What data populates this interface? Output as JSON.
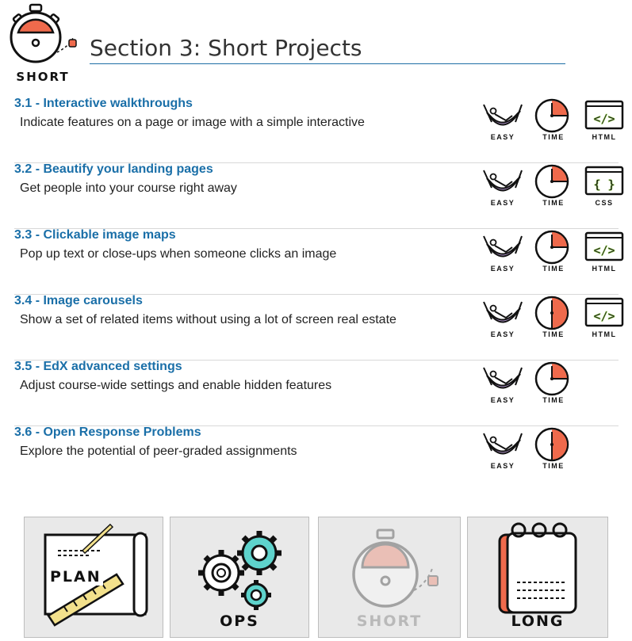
{
  "header": {
    "logo_label": "SHORT",
    "title": "Section 3: Short Projects"
  },
  "badges": {
    "easy": "EASY",
    "time": "TIME"
  },
  "projects": [
    {
      "title": "3.1 - Interactive walkthroughs",
      "desc": "Indicate features on a page or image with a simple interactive",
      "code_label": "HTML",
      "code_icon": "html-code-icon",
      "time_fraction": 0.25
    },
    {
      "title": "3.2 - Beautify your landing pages",
      "desc": "Get people into your course right away",
      "code_label": "CSS",
      "code_icon": "css-braces-icon",
      "time_fraction": 0.25
    },
    {
      "title": "3.3 - Clickable image maps",
      "desc": "Pop up text or close-ups when someone clicks an image",
      "code_label": "HTML",
      "code_icon": "html-code-icon",
      "time_fraction": 0.25
    },
    {
      "title": "3.4 - Image carousels",
      "desc": "Show a set of related items without using a lot of screen real estate",
      "code_label": "HTML",
      "code_icon": "html-code-icon",
      "time_fraction": 0.5
    },
    {
      "title": "3.5 - EdX advanced settings",
      "desc": "Adjust course-wide settings and enable hidden features",
      "code_label": "",
      "code_icon": "",
      "time_fraction": 0.25
    },
    {
      "title": "3.6 - Open Response Problems",
      "desc": "Explore the potential of peer-graded assignments",
      "code_label": "",
      "code_icon": "",
      "time_fraction": 0.5
    }
  ],
  "nav_tiles": [
    {
      "label": "PLAN",
      "icon": "plan-blueprint-icon"
    },
    {
      "label": "OPS",
      "icon": "ops-gears-icon"
    },
    {
      "label": "SHORT",
      "icon": "short-stopwatch-icon"
    },
    {
      "label": "LONG",
      "icon": "long-notepad-icon"
    }
  ],
  "colors": {
    "accent": "#1a6fa8",
    "orange": "#ef6a4c",
    "purple": "#b79ad2",
    "teal": "#5ed3cc",
    "code_green": "#9bd35a"
  }
}
